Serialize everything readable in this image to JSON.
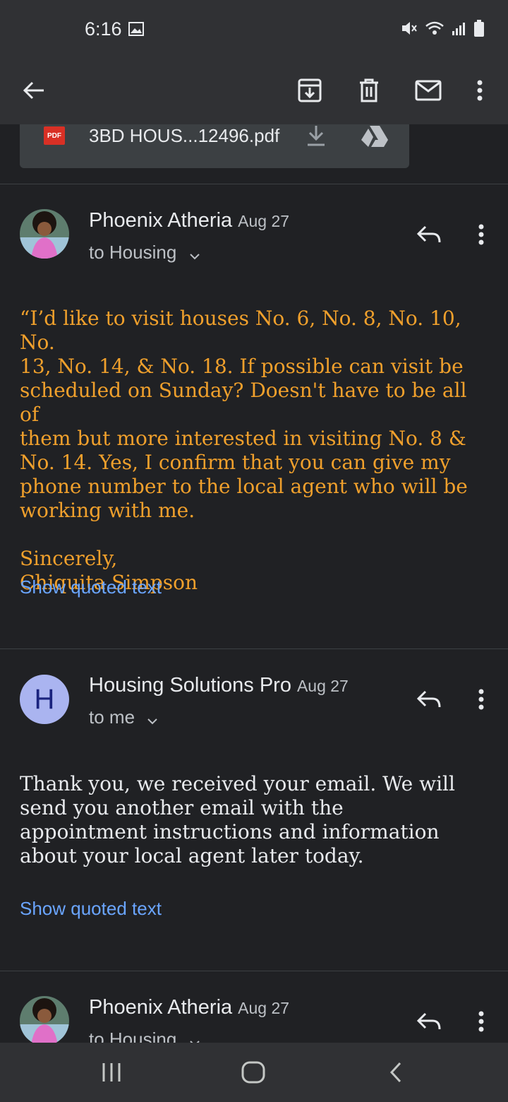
{
  "status_bar": {
    "time": "6:16"
  },
  "toolbar": {
    "back": "back-arrow-icon",
    "archive": "archive-icon",
    "delete": "trash-icon",
    "mark_unread": "mail-icon",
    "more": "more-vert-icon"
  },
  "attachment": {
    "type_label": "PDF",
    "filename": "3BD HOUS...12496.pdf"
  },
  "messages": [
    {
      "sender": "Phoenix Atheria",
      "date": "Aug 27",
      "recipient": "to Housing",
      "body_lines": [
        "“I’d like to visit houses No. 6, No. 8, No. 10, No.",
        "13, No. 14, & No. 18. If possible can visit be",
        "scheduled on Sunday? Doesn't have to be all of",
        "them but more interested in visiting No. 8 &",
        "No. 14. Yes, I confirm that you can give my",
        "phone number to the local agent who will be",
        "working with me."
      ],
      "signoff": "Sincerely,",
      "signature": "Chiquita Simpson",
      "show_quoted": "Show quoted text"
    },
    {
      "sender": "Housing Solutions Pro",
      "avatar_letter": "H",
      "date": "Aug 27",
      "recipient": "to me",
      "body_lines": [
        "Thank you, we received your email. We will",
        "send you another email with the",
        "appointment instructions and information",
        "about your local agent later today."
      ],
      "show_quoted": "Show quoted text"
    },
    {
      "sender": "Phoenix Atheria",
      "date": "Aug 27",
      "recipient": "to Housing"
    }
  ],
  "colors": {
    "background": "#202124",
    "bar": "#303134",
    "quote_orange": "#f0a02c",
    "link_blue": "#6aa5ff"
  }
}
